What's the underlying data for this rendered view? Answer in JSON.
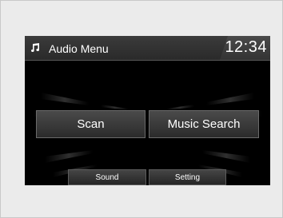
{
  "header": {
    "icon": "music-note-icon",
    "title": "Audio Menu",
    "clock": "12:34"
  },
  "buttons": {
    "scan": "Scan",
    "music_search": "Music Search",
    "sound": "Sound",
    "setting": "Setting"
  },
  "colors": {
    "screen_background": "#000000",
    "button_text": "#ffffff",
    "page_background": "#ebebeb"
  }
}
